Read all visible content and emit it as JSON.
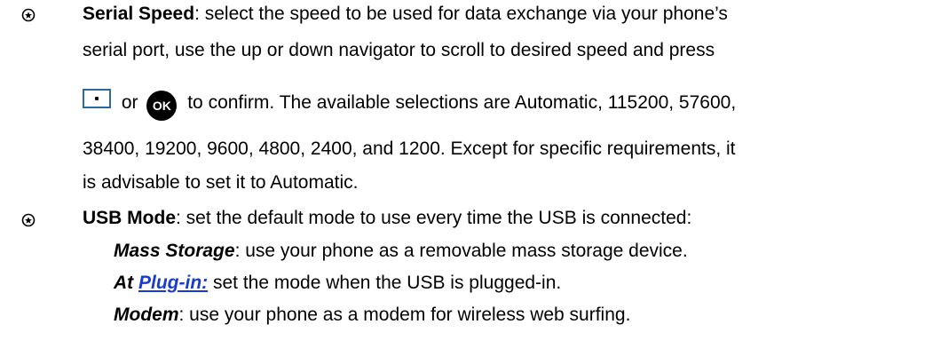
{
  "serial_speed": {
    "term": "Serial Speed",
    "line1_rest": ": select the speed to be used for data exchange    via your phone’s",
    "line2": "serial port, use the up or down navigator to scroll to desired speed and press",
    "line3_or": "or",
    "ok_icon_text": "OK",
    "line3_rest": "to confirm. The available selections are Automatic, 115200, 57600,",
    "line4": "38400, 19200, 9600, 4800, 2400, and 1200. Except for specific requirements, it",
    "line5": "is advisable to set it to Automatic."
  },
  "usb_mode": {
    "term": "USB Mode",
    "line1_rest": ": set the default mode to use every time the USB is connected:",
    "options": [
      {
        "term": "Mass Storage",
        "desc": ": use your phone as a removable mass storage device."
      },
      {
        "term_prefix": "At ",
        "term_link": "Plug-in:",
        "desc": " set the mode when the USB is plugged-in."
      },
      {
        "term": "Modem",
        "desc": ": use your phone as a modem for wireless web surfing."
      }
    ]
  },
  "icons": {
    "bullet": "star-circle-bullet-icon",
    "softkey": "softkey-center-icon",
    "ok": "ok-button-icon"
  }
}
